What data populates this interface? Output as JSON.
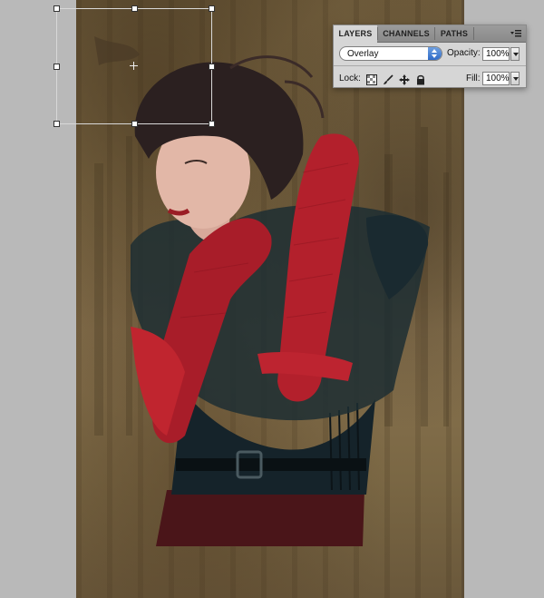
{
  "layers_panel": {
    "tabs": [
      {
        "label": "LAYERS",
        "active": true
      },
      {
        "label": "CHANNELS",
        "active": false
      },
      {
        "label": "PATHS",
        "active": false
      }
    ],
    "blend_mode": "Overlay",
    "opacity_label": "Opacity:",
    "opacity_value": "100%",
    "lock_label": "Lock:",
    "fill_label": "Fill:",
    "fill_value": "100%",
    "lock_icons": [
      "lock-transparent-pixels-icon",
      "lock-image-pixels-icon",
      "lock-position-icon",
      "lock-all-icon"
    ]
  },
  "colors": {
    "background": "#b9b9b9",
    "panel": "#d6d6d6",
    "accent_blue": "#2f6bc8",
    "glove_red": "#b3202c"
  }
}
